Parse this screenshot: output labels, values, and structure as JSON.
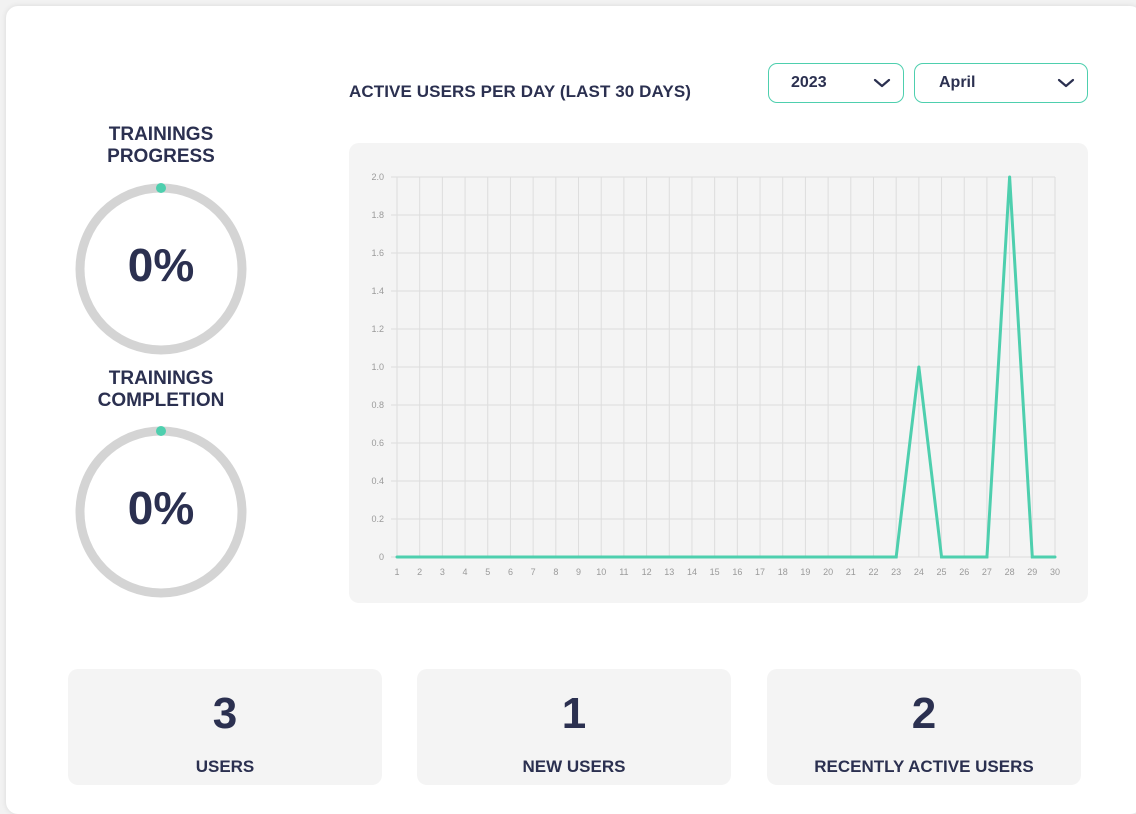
{
  "header": {
    "chart_title": "ACTIVE USERS PER DAY (LAST 30 DAYS)",
    "year_select": {
      "value": "2023",
      "icon": "chevron-down-icon"
    },
    "month_select": {
      "value": "April",
      "icon": "chevron-down-icon"
    }
  },
  "donuts": [
    {
      "title_line1": "TRAININGS",
      "title_line2": "PROGRESS",
      "value": "0%",
      "percent": 0
    },
    {
      "title_line1": "TRAININGS",
      "title_line2": "COMPLETION",
      "value": "0%",
      "percent": 0
    }
  ],
  "colors": {
    "accent": "#4ecfae",
    "text": "#2b3050",
    "track": "#d4d4d4",
    "panel": "#f4f4f4"
  },
  "stats": [
    {
      "value": "3",
      "label": "USERS"
    },
    {
      "value": "1",
      "label": "NEW USERS"
    },
    {
      "value": "2",
      "label": "RECENTLY ACTIVE USERS"
    }
  ],
  "chart_data": {
    "type": "line",
    "title": "ACTIVE USERS PER DAY (LAST 30 DAYS)",
    "xlabel": "",
    "ylabel": "",
    "x": [
      1,
      2,
      3,
      4,
      5,
      6,
      7,
      8,
      9,
      10,
      11,
      12,
      13,
      14,
      15,
      16,
      17,
      18,
      19,
      20,
      21,
      22,
      23,
      24,
      25,
      26,
      27,
      28,
      29,
      30
    ],
    "series": [
      {
        "values": [
          0,
          0,
          0,
          0,
          0,
          0,
          0,
          0,
          0,
          0,
          0,
          0,
          0,
          0,
          0,
          0,
          0,
          0,
          0,
          0,
          0,
          0,
          0,
          1,
          0,
          0,
          0,
          2,
          0,
          0
        ]
      }
    ],
    "ylim": [
      0,
      2.0
    ],
    "yticks": [
      "0",
      "0.2",
      "0.4",
      "0.6",
      "0.8",
      "1.0",
      "1.2",
      "1.4",
      "1.6",
      "1.8",
      "2.0"
    ],
    "grid": true
  }
}
